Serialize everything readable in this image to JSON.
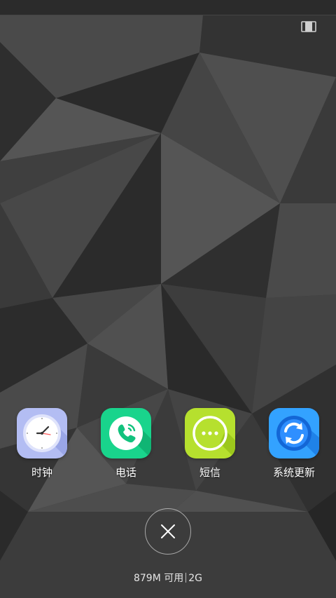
{
  "recents": {
    "apps": [
      {
        "label": "时钟",
        "icon": "clock-icon",
        "color": "#b8c2f5"
      },
      {
        "label": "电话",
        "icon": "phone-icon",
        "color": "#18d58c"
      },
      {
        "label": "短信",
        "icon": "message-icon",
        "color": "#b6e02e"
      },
      {
        "label": "系统更新",
        "icon": "system-update-icon",
        "color": "#2f8fff"
      }
    ],
    "close_icon": "close-icon",
    "view_toggle_icon": "view-toggle-icon"
  },
  "memory": {
    "available": "879M 可用",
    "total": "2G"
  },
  "colors": {
    "wallpaper_base": "#3a3a3a",
    "statusbar": "#2b2b2b"
  }
}
